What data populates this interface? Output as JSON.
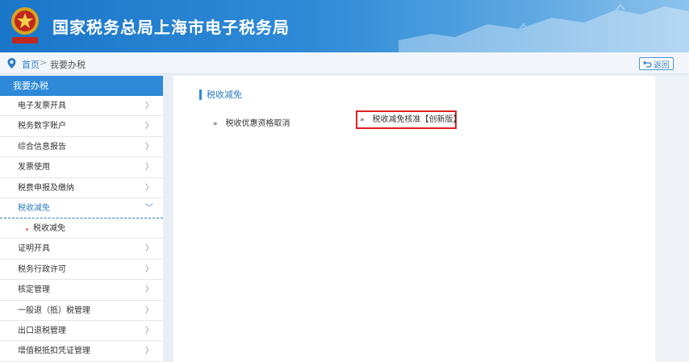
{
  "header": {
    "title": "国家税务总局上海市电子税务局",
    "brand_color": "#1a76c9"
  },
  "breadcrumb": {
    "home": "首页",
    "separator": ">",
    "current": "我要办税",
    "back_label": "返回"
  },
  "sidebar": {
    "heading": "我要办税",
    "items": [
      {
        "label": "电子发票开具"
      },
      {
        "label": "税务数字账户"
      },
      {
        "label": "综合信息报告"
      },
      {
        "label": "发票使用"
      },
      {
        "label": "税费申报及缴纳"
      },
      {
        "label": "税收减免",
        "expanded": true
      },
      {
        "label": "证明开具"
      },
      {
        "label": "税务行政许可"
      },
      {
        "label": "核定管理"
      },
      {
        "label": "一般退（抵）税管理"
      },
      {
        "label": "出口退税管理"
      },
      {
        "label": "增值税抵扣凭证管理"
      }
    ],
    "sub_items": [
      {
        "label": "税收减免"
      }
    ],
    "active_color": "#2c7bc5"
  },
  "main": {
    "section_title": "税收减免",
    "services": [
      {
        "label": "税收优惠资格取消"
      },
      {
        "label": "税收减免核准【创新版】",
        "highlighted": true
      }
    ],
    "highlight_color": "#e02020"
  }
}
